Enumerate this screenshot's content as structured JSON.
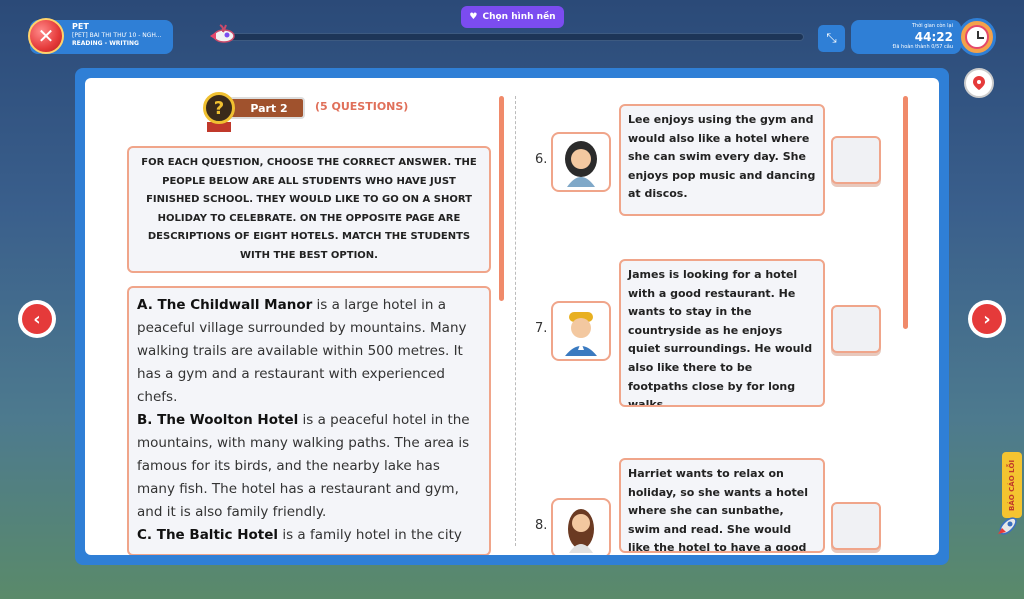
{
  "header": {
    "course": "PET",
    "test_name": "[PET] BÀI THI THỬ 10 - NGH...",
    "skill": "READING - WRITING",
    "bg_button_label": "Chọn hình nền",
    "timer_label": "Thời gian còn lại",
    "timer_value": "44:22",
    "completed_label": "Đã hoàn thành 0/57 câu",
    "progress": 0
  },
  "part": {
    "label": "Part 2",
    "count": "(5 QUESTIONS)"
  },
  "instructions": "FOR EACH QUESTION, CHOOSE THE CORRECT ANSWER. THE PEOPLE BELOW ARE ALL STUDENTS WHO HAVE JUST FINISHED SCHOOL. THEY WOULD LIKE TO GO ON A SHORT HOLIDAY TO CELEBRATE. ON THE OPPOSITE PAGE ARE DESCRIPTIONS OF EIGHT HOTELS. MATCH THE STUDENTS WITH THE BEST OPTION.",
  "hotels": [
    {
      "name": "A. The Childwall Manor",
      "text": " is a large hotel in a peaceful village surrounded by mountains. Many walking trails are available within 500 metres. It has a gym and a restaurant with experienced chefs."
    },
    {
      "name": "B. The Woolton Hotel",
      "text": " is a peaceful hotel in the mountains, with many walking paths. The area is famous for its birds, and the nearby lake has many fish. The hotel has a restaurant and gym, and it is also family friendly."
    },
    {
      "name": "C. The Baltic Hotel",
      "text": " is a family hotel in the city"
    }
  ],
  "questions": [
    {
      "number": "6.",
      "text": "Lee enjoys using the gym and would also like a hotel where she can swim every day. She enjoys pop music and dancing at discos."
    },
    {
      "number": "7.",
      "text": "James is looking for a hotel with a good restaurant. He wants to stay in the countryside as he enjoys quiet surroundings. He would also like there to be footpaths close by for long walks."
    },
    {
      "number": "8.",
      "text": "Harriet wants to relax on holiday, so she wants a hotel where she can sunbathe, swim and read. She would like the hotel to have a good"
    }
  ],
  "side": {
    "report_label": "BÁO CÁO LỖI"
  },
  "colors": {
    "accent_blue": "#2f7fd6",
    "accent_orange": "#f0a58a",
    "nav_red": "#e53a3a",
    "bg_button": "#7b4cf0"
  }
}
